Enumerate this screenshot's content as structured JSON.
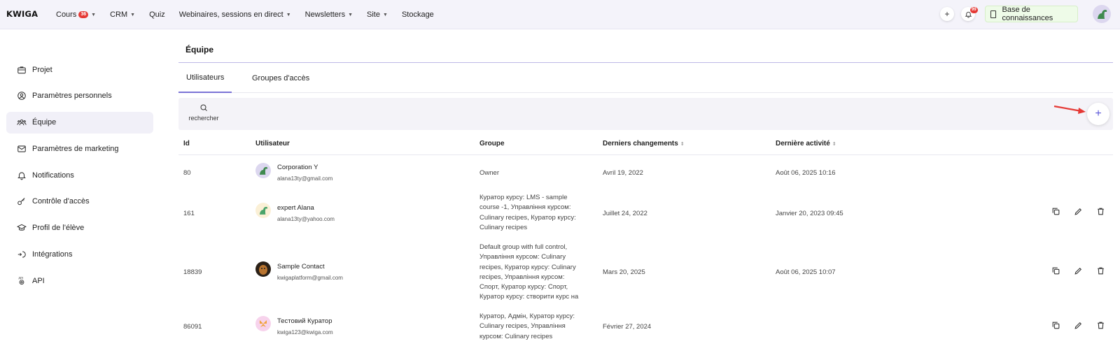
{
  "app": {
    "logo": "KWIGA"
  },
  "nav": [
    {
      "label": "Cours",
      "badge": "36",
      "dropdown": true
    },
    {
      "label": "CRM",
      "dropdown": true
    },
    {
      "label": "Quiz",
      "dropdown": false
    },
    {
      "label": "Webinaires, sessions en direct",
      "dropdown": true
    },
    {
      "label": "Newsletters",
      "dropdown": true
    },
    {
      "label": "Site",
      "dropdown": true
    },
    {
      "label": "Stockage",
      "dropdown": false
    }
  ],
  "topbar": {
    "plus_label": "+",
    "notif_badge": "99",
    "knowledge_base": "Base de connaissances"
  },
  "sidebar": {
    "items": [
      {
        "label": "Projet",
        "icon": "briefcase-icon"
      },
      {
        "label": "Paramètres personnels",
        "icon": "user-circle-icon"
      },
      {
        "label": "Équipe",
        "icon": "team-icon",
        "active": true
      },
      {
        "label": "Paramètres de marketing",
        "icon": "mail-icon"
      },
      {
        "label": "Notifications",
        "icon": "bell-icon"
      },
      {
        "label": "Contrôle d'accès",
        "icon": "key-icon"
      },
      {
        "label": "Profil de l'élève",
        "icon": "graduation-cap-icon"
      },
      {
        "label": "Intégrations",
        "icon": "integrations-icon"
      },
      {
        "label": "API",
        "icon": "api-icon"
      }
    ]
  },
  "main": {
    "title": "Équipe",
    "tabs": [
      {
        "label": "Utilisateurs",
        "active": true
      },
      {
        "label": "Groupes d'accès"
      }
    ],
    "search": {
      "label": "rechercher"
    },
    "add_label": "+"
  },
  "table": {
    "columns": {
      "id": "Id",
      "user": "Utilisateur",
      "group": "Groupe",
      "changes": "Derniers changements",
      "activity": "Dernière activité"
    },
    "rows": [
      {
        "id": "80",
        "name": "Corporation Y",
        "email": "alana13ty@gmail.com",
        "group": "Owner",
        "changes": "Avril 19, 2022",
        "activity": "Août 06, 2025 10:16",
        "actions": false
      },
      {
        "id": "161",
        "name": "expert Alana",
        "email": "alana13ty@yahoo.com",
        "group": "Куратор курсу: LMS - sample course -1, Управління курсом: Culinary recipes, Куратор курсу: Culinary recipes",
        "changes": "Juillet 24, 2022",
        "activity": "Janvier 20, 2023 09:45",
        "actions": true
      },
      {
        "id": "18839",
        "name": "Sample Contact",
        "email": "kwigaplatform@gmail.com",
        "group": "Default group with full control, Управління курсом: Culinary recipes, Куратор курсу: Culinary recipes, Управління курсом: Спорт, Куратор курсу: Спорт, Куратор курсу: створити курс на kwiga",
        "changes": "Mars 20, 2025",
        "activity": "Août 06, 2025 10:07",
        "actions": true
      },
      {
        "id": "86091",
        "name": "Тестовий Куратор",
        "email": "kwiga123@kwiga.com",
        "group": "Куратор, Адмін, Куратор курсу: Culinary recipes, Управління курсом: Culinary recipes",
        "changes": "Février 27, 2024",
        "activity": "",
        "actions": true
      }
    ]
  },
  "colors": {
    "accent": "#5a56d8",
    "tab_underline": "#7b73d6",
    "badge_red": "#e53935",
    "arrow_red": "#e53935"
  }
}
